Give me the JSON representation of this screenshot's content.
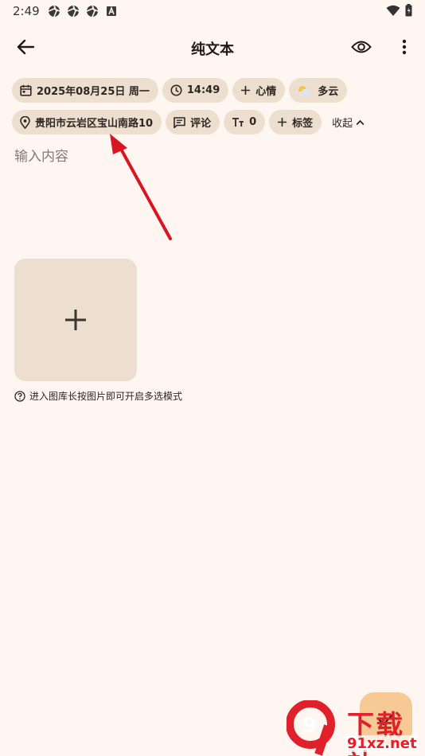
{
  "status_bar": {
    "time": "2:49",
    "icons": [
      "aperture-icon",
      "aperture-icon",
      "aperture-icon",
      "font-a-icon"
    ],
    "right_icons": [
      "wifi-icon",
      "battery-icon"
    ]
  },
  "app_bar": {
    "title": "纯文本",
    "back_icon": "arrow-left-icon",
    "preview_icon": "eye-icon",
    "more_icon": "more-vert-icon"
  },
  "chips": {
    "date": "2025年08月25日 周一",
    "time": "14:49",
    "mood": "心情",
    "weather": "多云",
    "location": "贵阳市云岩区宝山南路10",
    "comment": "评论",
    "text_size_value": "0",
    "tag": "标签",
    "collapse": "收起"
  },
  "editor": {
    "placeholder": "输入内容",
    "value": ""
  },
  "gallery": {
    "hint": "进入图库长按图片即可开启多选模式"
  },
  "watermark": {
    "brand": "下载站",
    "url": "91xz.net",
    "logo_text": "9"
  },
  "colors": {
    "background": "#fff6f1",
    "chip": "#ecdfd0",
    "fab": "#f7c995",
    "annotation_arrow": "#d9161f"
  }
}
